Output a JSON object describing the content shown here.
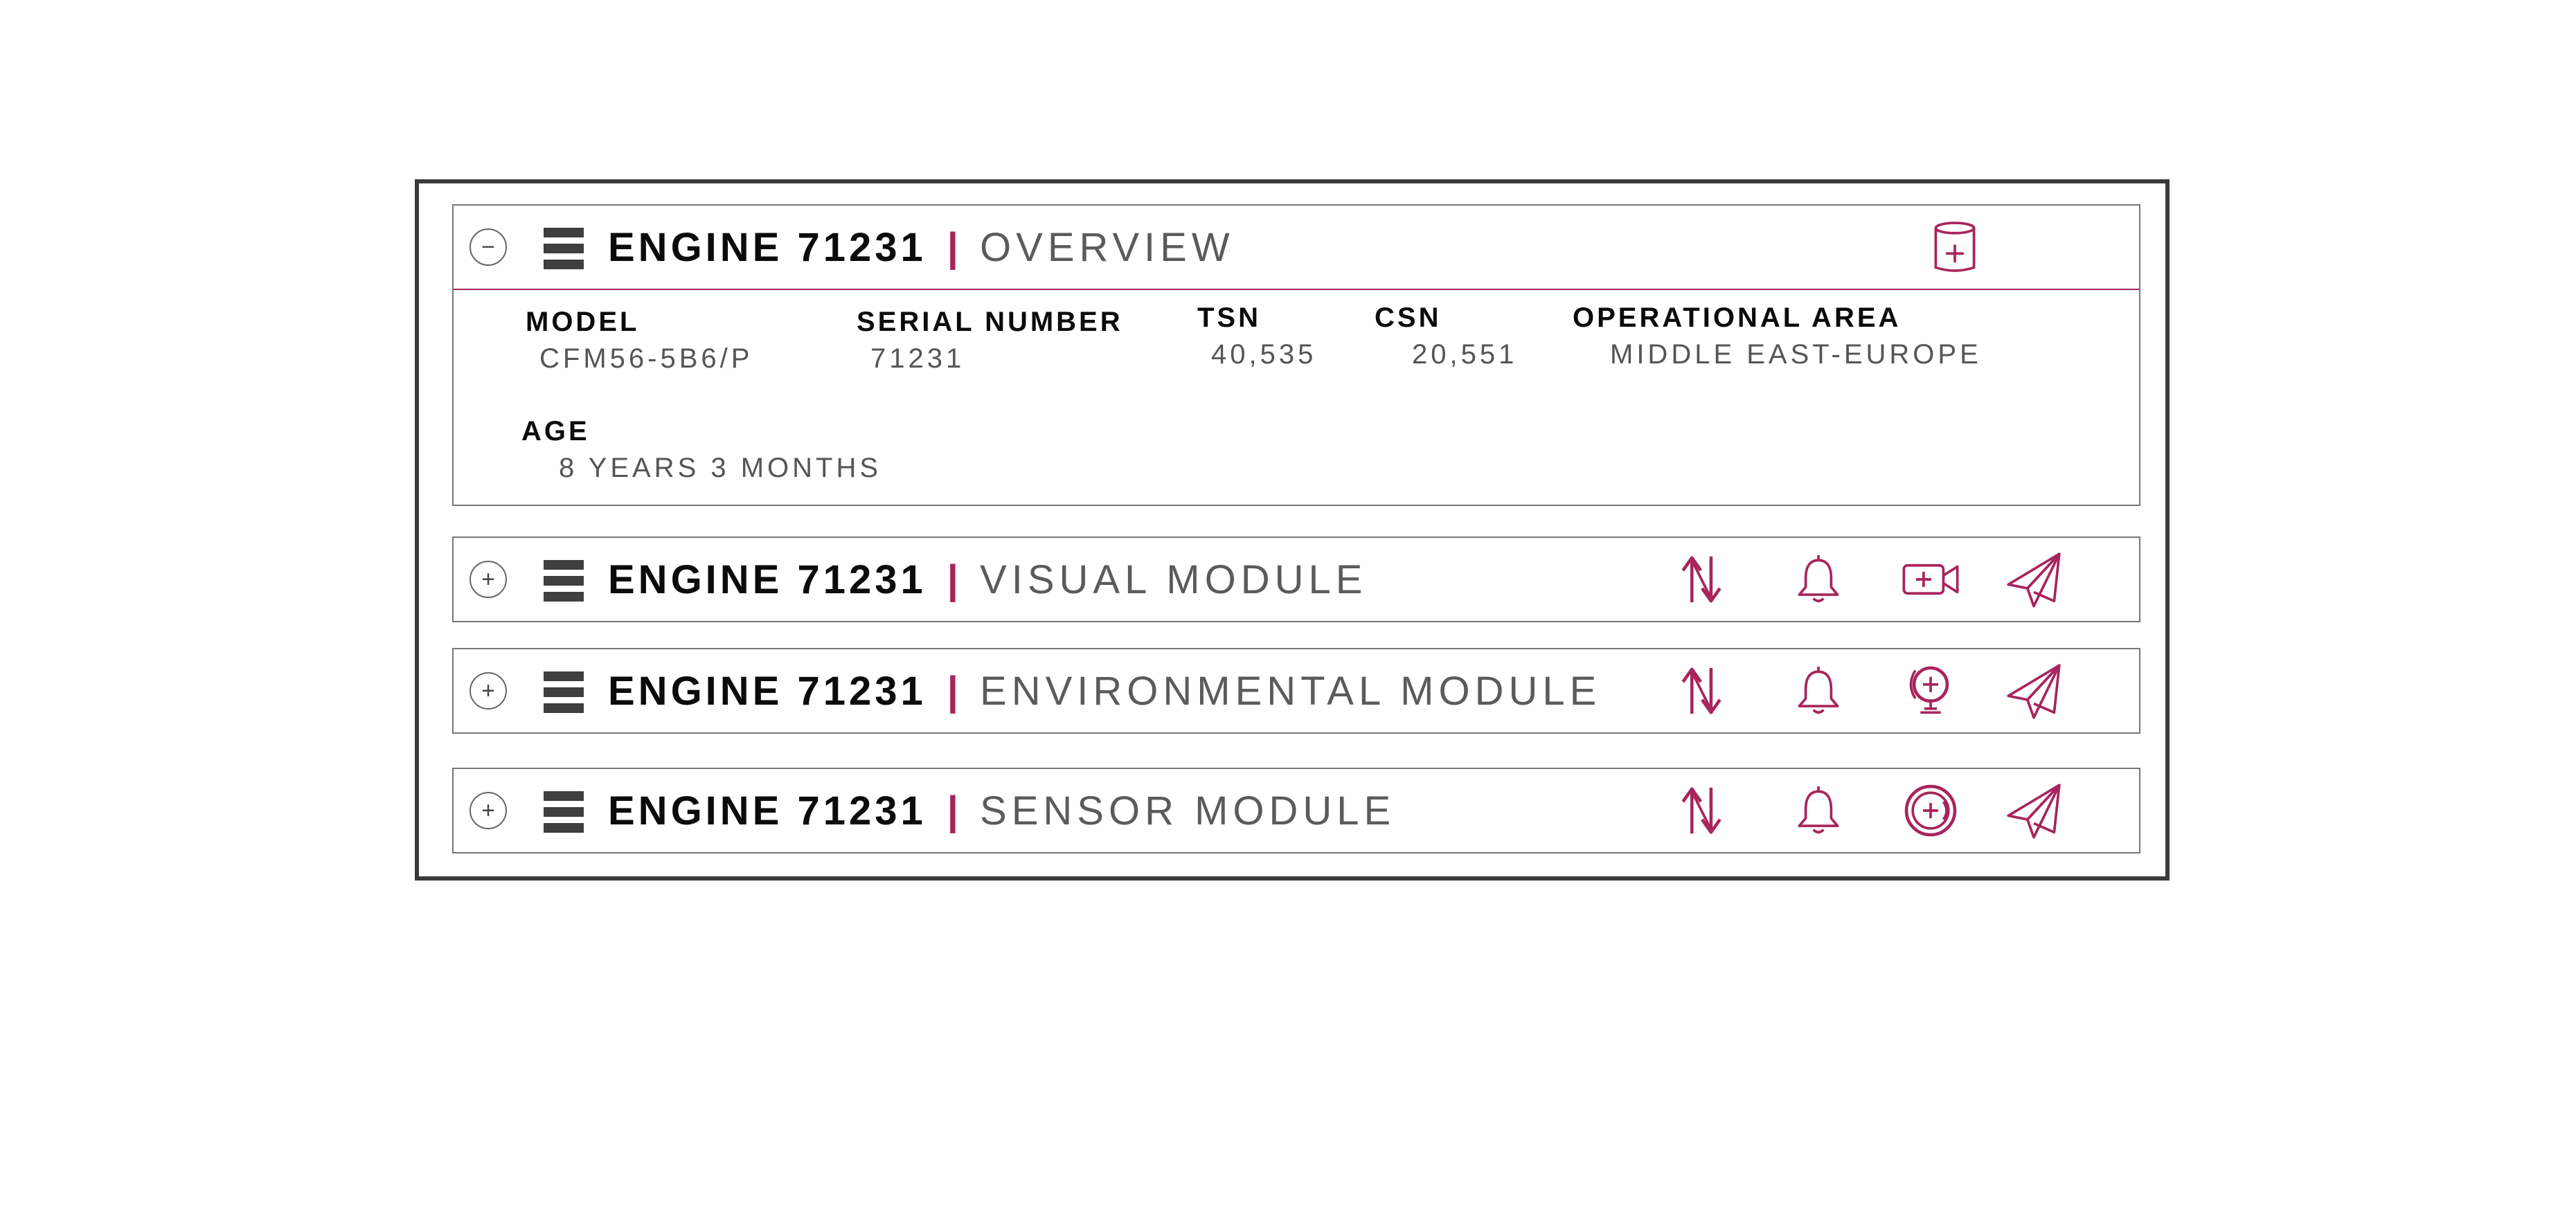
{
  "colors": {
    "accent": "#a8245c",
    "frame": "#3a3a3a",
    "menu": "#3f3f3f"
  },
  "panels": [
    {
      "toggle": "−",
      "engine": "ENGINE 71231",
      "separator": "|",
      "module": "OVERVIEW",
      "icons": [
        "database-plus-icon"
      ],
      "fields": [
        {
          "label": "MODEL",
          "value": "CFM56-5B6/P"
        },
        {
          "label": "SERIAL NUMBER",
          "value": "71231"
        },
        {
          "label": "TSN",
          "value": "40,535"
        },
        {
          "label": "CSN",
          "value": "20,551"
        },
        {
          "label": "OPERATIONAL AREA",
          "value": "MIDDLE EAST-EUROPE"
        },
        {
          "label": "AGE",
          "value": "8 YEARS 3 MONTHS"
        }
      ]
    },
    {
      "toggle": "+",
      "engine": "ENGINE 71231",
      "separator": "|",
      "module": "VISUAL MODULE",
      "icons": [
        "transfer-arrows-icon",
        "bell-icon",
        "video-camera-plus-icon",
        "paper-plane-icon"
      ]
    },
    {
      "toggle": "+",
      "engine": "ENGINE 71231",
      "separator": "|",
      "module": "ENVIRONMENTAL MODULE",
      "icons": [
        "transfer-arrows-icon",
        "bell-icon",
        "globe-plus-icon",
        "paper-plane-icon"
      ]
    },
    {
      "toggle": "+",
      "engine": "ENGINE 71231",
      "separator": "|",
      "module": "SENSOR MODULE",
      "icons": [
        "transfer-arrows-icon",
        "bell-icon",
        "sensor-plus-icon",
        "paper-plane-icon"
      ]
    }
  ]
}
